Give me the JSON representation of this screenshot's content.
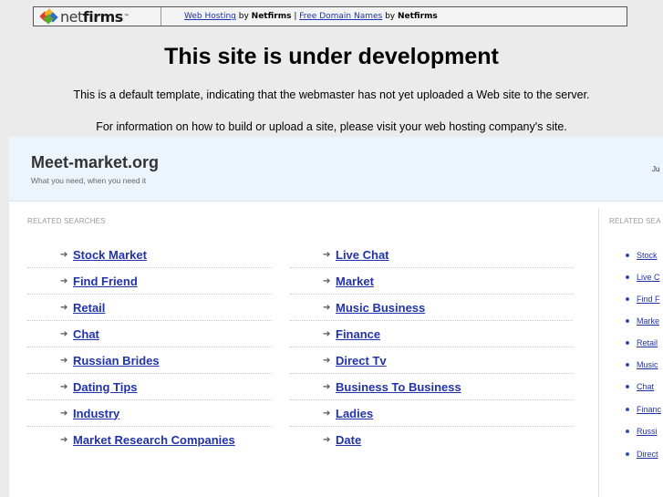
{
  "banner": {
    "logo_text_net": "net",
    "logo_text_firms": "firms",
    "logo_tm": "™",
    "link_hosting": "Web Hosting",
    "by1": " by ",
    "brand1": "Netfirms",
    "sep": " | ",
    "link_domains": "Free Domain Names",
    "by2": " by ",
    "brand2": "Netfirms"
  },
  "dev": {
    "title": "This site is under development",
    "line1": "This is a default template, indicating that the webmaster has not yet uploaded a Web site to the server.",
    "line2": "For information on how to build or upload a site, please visit your web hosting company's site."
  },
  "parked": {
    "site_name": "Meet-market.org",
    "tagline": "What you need, when you need it",
    "header_right": "Ju",
    "related_label": "RELATED SEARCHES",
    "related_label_right": "RELATED SEA",
    "left_col": [
      "Stock Market",
      "Find Friend",
      "Retail",
      "Chat",
      "Russian Brides",
      "Dating Tips",
      "Industry",
      "Market Research Companies"
    ],
    "right_col": [
      "Live Chat",
      "Market",
      "Music Business",
      "Finance",
      "Direct Tv",
      "Business To Business",
      "Ladies",
      "Date"
    ],
    "side_col": [
      "Stock",
      "Live C",
      "Find F",
      "Marke",
      "Retail",
      "Music",
      "Chat",
      "Financ",
      "Russi",
      "Direct"
    ]
  }
}
